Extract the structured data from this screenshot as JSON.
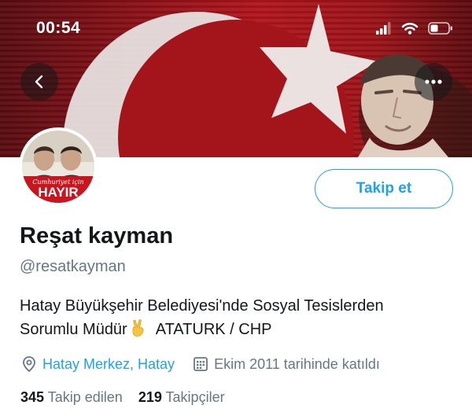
{
  "status_bar": {
    "time": "00:54"
  },
  "icons": {
    "back": "chevron-left-icon",
    "more": "more-horizontal-icon",
    "location": "location-pin-icon",
    "calendar": "calendar-icon",
    "emoji": "victory-hand-emoji"
  },
  "avatar": {
    "text_line1": "Cumhuriyet için",
    "text_line2": "HAYIR"
  },
  "profile": {
    "follow_label": "Takip et",
    "display_name": "Reşat kayman",
    "handle": "@resatkayman",
    "bio_line1": "Hatay Büyükşehir Belediyesi'nde Sosyal Tesislerden",
    "bio_line2a": "Sorumlu Müdür",
    "bio_line2b": "ATATURK / CHP",
    "location": "Hatay Merkez, Hatay",
    "joined": "Ekim 2011 tarihinde katıldı",
    "following_count": "345",
    "following_label": "Takip edilen",
    "followers_count": "219",
    "followers_label": "Takipçiler"
  },
  "colors": {
    "accent": "#1da1f2",
    "secondary_text": "#657786",
    "banner_red": "#b3161d"
  }
}
